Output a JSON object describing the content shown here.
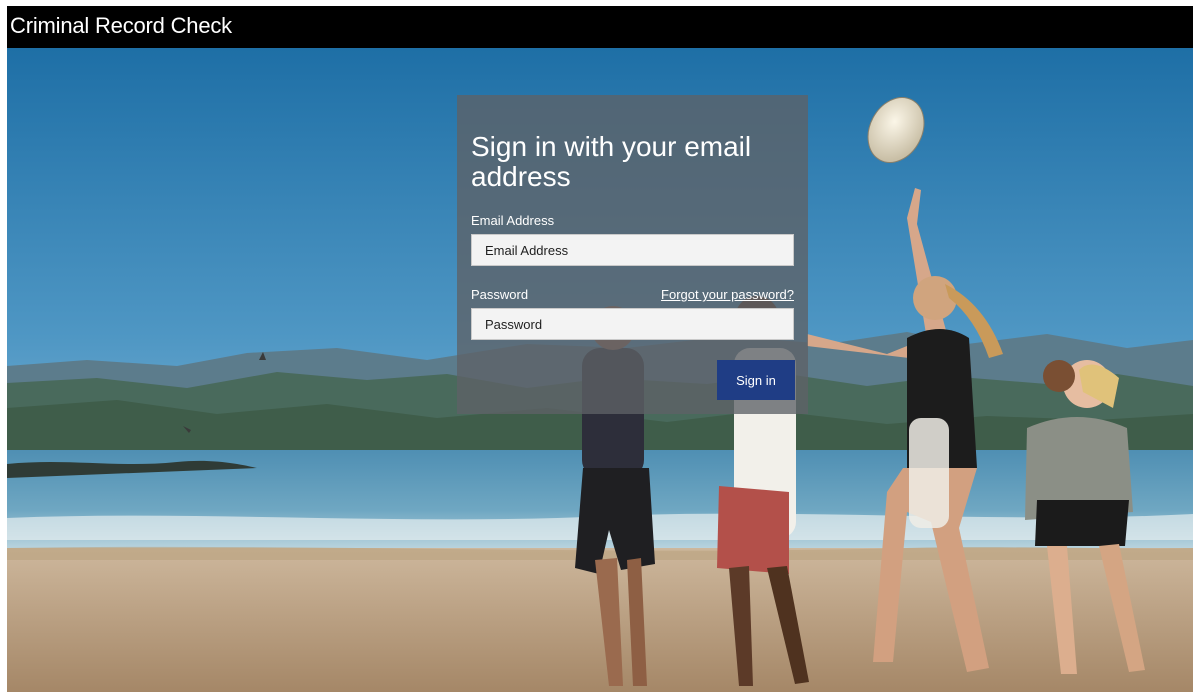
{
  "header": {
    "title": "Criminal Record Check"
  },
  "login": {
    "heading": "Sign in with your email address",
    "email_label": "Email Address",
    "email_placeholder": "Email Address",
    "email_value": "",
    "password_label": "Password",
    "password_placeholder": "Password",
    "password_value": "",
    "forgot_password_label": "Forgot your password?",
    "sign_in_label": "Sign in"
  },
  "colors": {
    "header_background": "#000000",
    "panel_background": "#5d6266",
    "sign_in_button": "#1f3d85",
    "text": "#ffffff"
  }
}
